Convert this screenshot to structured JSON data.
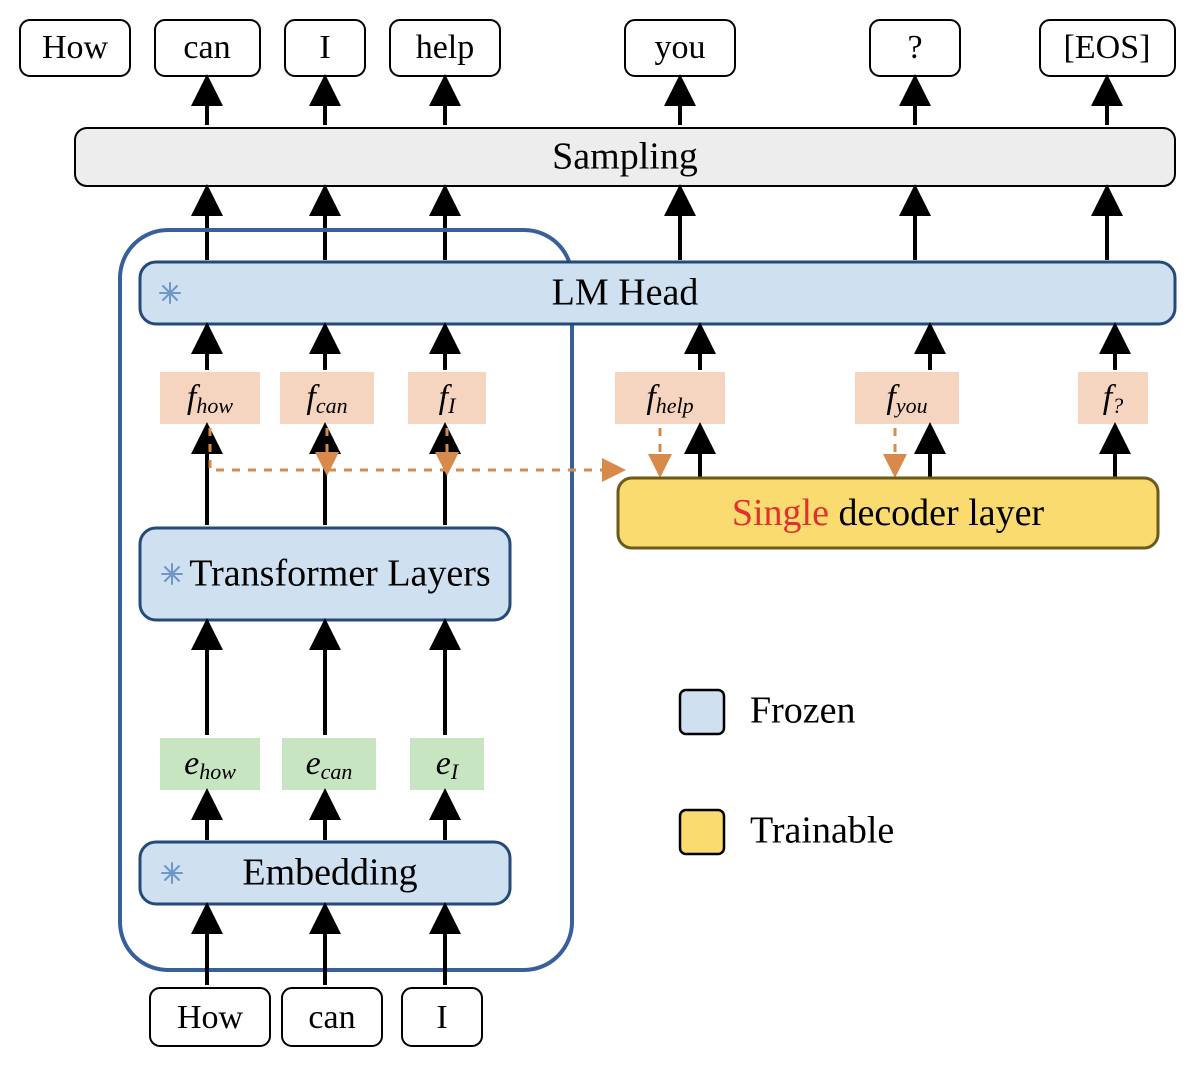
{
  "output_tokens": [
    "How",
    "can",
    "I",
    "help",
    "you",
    "?",
    "[EOS]"
  ],
  "sampling_label": "Sampling",
  "lm_head_label": "LM Head",
  "f_chips": [
    {
      "var": "f",
      "sub": "how"
    },
    {
      "var": "f",
      "sub": "can"
    },
    {
      "var": "f",
      "sub": "I"
    },
    {
      "var": "f",
      "sub": "help"
    },
    {
      "var": "f",
      "sub": "you"
    },
    {
      "var": "f",
      "sub": "?"
    }
  ],
  "decoder": {
    "word_single": "Single",
    "rest": " decoder layer"
  },
  "transformer_label": "Transformer Layers",
  "e_chips": [
    {
      "var": "e",
      "sub": "how"
    },
    {
      "var": "e",
      "sub": "can"
    },
    {
      "var": "e",
      "sub": "I"
    }
  ],
  "embedding_label": "Embedding",
  "input_tokens": [
    "How",
    "can",
    "I"
  ],
  "legend": {
    "frozen": "Frozen",
    "trainable": "Trainable"
  },
  "colors": {
    "frozen_fill": "#cfe0f0",
    "trainable_fill": "#f9db70",
    "peach": "#f6d5c0",
    "green": "#c7e5c1"
  }
}
